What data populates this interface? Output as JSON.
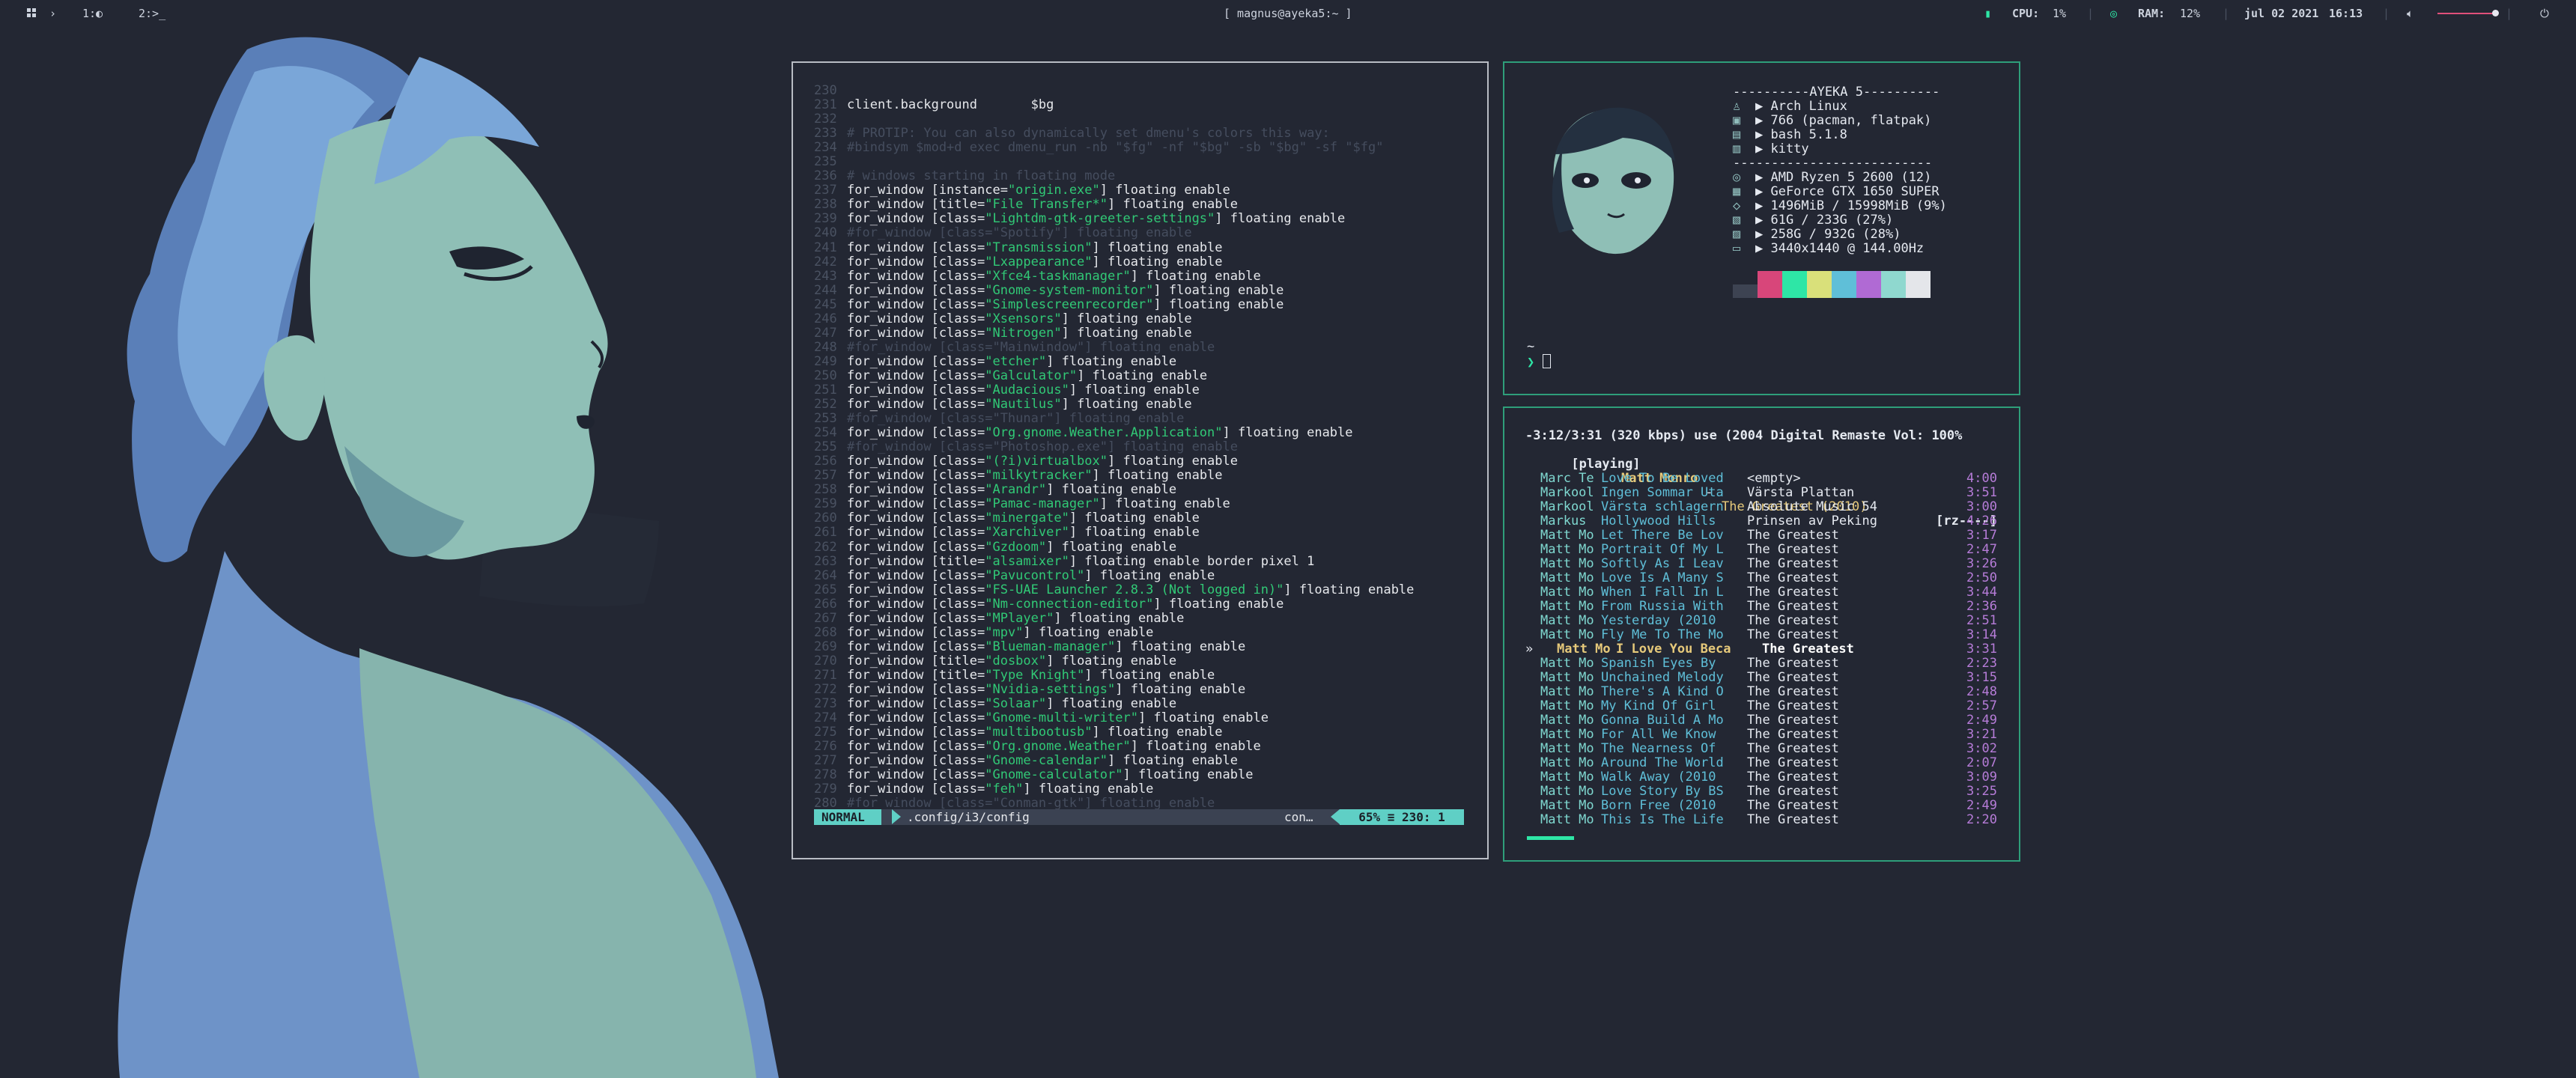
{
  "topbar": {
    "workspaces_icon": "grid-icon",
    "chevron": "›",
    "ws1": "1:◐",
    "ws2": "2:>_",
    "window_title": "[ magnus@ayeka5:~ ]",
    "cpu_label": "CPU:",
    "cpu_value": "1%",
    "ram_label": "RAM:",
    "ram_value": "12%",
    "date": "jul 02 2021",
    "time": "16:13",
    "volume_level": 0.92,
    "accent_color": "#2ee6a6"
  },
  "vim": {
    "lines": [
      {
        "n": "230",
        "segs": []
      },
      {
        "n": "231",
        "segs": [
          {
            "k": "t",
            "v": "client.background       $bg"
          }
        ]
      },
      {
        "n": "232",
        "segs": []
      },
      {
        "n": "233",
        "segs": [
          {
            "k": "c",
            "v": "# PROTIP: You can also dynamically set dmenu's colors this way:"
          }
        ]
      },
      {
        "n": "234",
        "segs": [
          {
            "k": "c",
            "v": "#bindsym $mod+d exec dmenu_run -nb \"$fg\" -nf \"$bg\" -sb \"$bg\" -sf \"$fg\""
          }
        ]
      },
      {
        "n": "235",
        "segs": []
      },
      {
        "n": "236",
        "segs": [
          {
            "k": "c",
            "v": "# windows starting in floating mode"
          }
        ]
      },
      {
        "n": "237",
        "segs": [
          {
            "k": "t",
            "v": "for_window [instance="
          },
          {
            "k": "s",
            "v": "\"origin.exe\""
          },
          {
            "k": "t",
            "v": "] floating enable"
          }
        ]
      },
      {
        "n": "238",
        "segs": [
          {
            "k": "t",
            "v": "for_window [title="
          },
          {
            "k": "s",
            "v": "\"File Transfer*\""
          },
          {
            "k": "t",
            "v": "] floating enable"
          }
        ]
      },
      {
        "n": "239",
        "segs": [
          {
            "k": "t",
            "v": "for_window [class="
          },
          {
            "k": "s",
            "v": "\"Lightdm-gtk-greeter-settings\""
          },
          {
            "k": "t",
            "v": "] floating enable"
          }
        ]
      },
      {
        "n": "240",
        "segs": [
          {
            "k": "c",
            "v": "#for_window [class=\"Spotify\"] floating enable"
          }
        ]
      },
      {
        "n": "241",
        "segs": [
          {
            "k": "t",
            "v": "for_window [class="
          },
          {
            "k": "s",
            "v": "\"Transmission\""
          },
          {
            "k": "t",
            "v": "] floating enable"
          }
        ]
      },
      {
        "n": "242",
        "segs": [
          {
            "k": "t",
            "v": "for_window [class="
          },
          {
            "k": "s",
            "v": "\"Lxappearance\""
          },
          {
            "k": "t",
            "v": "] floating enable"
          }
        ]
      },
      {
        "n": "243",
        "segs": [
          {
            "k": "t",
            "v": "for_window [class="
          },
          {
            "k": "s",
            "v": "\"Xfce4-taskmanager\""
          },
          {
            "k": "t",
            "v": "] floating enable"
          }
        ]
      },
      {
        "n": "244",
        "segs": [
          {
            "k": "t",
            "v": "for_window [class="
          },
          {
            "k": "s",
            "v": "\"Gnome-system-monitor\""
          },
          {
            "k": "t",
            "v": "] floating enable"
          }
        ]
      },
      {
        "n": "245",
        "segs": [
          {
            "k": "t",
            "v": "for_window [class="
          },
          {
            "k": "s",
            "v": "\"Simplescreenrecorder\""
          },
          {
            "k": "t",
            "v": "] floating enable"
          }
        ]
      },
      {
        "n": "246",
        "segs": [
          {
            "k": "t",
            "v": "for_window [class="
          },
          {
            "k": "s",
            "v": "\"Xsensors\""
          },
          {
            "k": "t",
            "v": "] floating enable"
          }
        ]
      },
      {
        "n": "247",
        "segs": [
          {
            "k": "t",
            "v": "for_window [class="
          },
          {
            "k": "s",
            "v": "\"Nitrogen\""
          },
          {
            "k": "t",
            "v": "] floating enable"
          }
        ]
      },
      {
        "n": "248",
        "segs": [
          {
            "k": "c",
            "v": "#for_window [class=\"Mainwindow\"] floating enable"
          }
        ]
      },
      {
        "n": "249",
        "segs": [
          {
            "k": "t",
            "v": "for_window [class="
          },
          {
            "k": "s",
            "v": "\"etcher\""
          },
          {
            "k": "t",
            "v": "] floating enable"
          }
        ]
      },
      {
        "n": "250",
        "segs": [
          {
            "k": "t",
            "v": "for_window [class="
          },
          {
            "k": "s",
            "v": "\"Galculator\""
          },
          {
            "k": "t",
            "v": "] floating enable"
          }
        ]
      },
      {
        "n": "251",
        "segs": [
          {
            "k": "t",
            "v": "for_window [class="
          },
          {
            "k": "s",
            "v": "\"Audacious\""
          },
          {
            "k": "t",
            "v": "] floating enable"
          }
        ]
      },
      {
        "n": "252",
        "segs": [
          {
            "k": "t",
            "v": "for_window [class="
          },
          {
            "k": "s",
            "v": "\"Nautilus\""
          },
          {
            "k": "t",
            "v": "] floating enable"
          }
        ]
      },
      {
        "n": "253",
        "segs": [
          {
            "k": "c",
            "v": "#for_window [class=\"Thunar\"] floating enable"
          }
        ]
      },
      {
        "n": "254",
        "segs": [
          {
            "k": "t",
            "v": "for_window [class="
          },
          {
            "k": "s",
            "v": "\"Org.gnome.Weather.Application\""
          },
          {
            "k": "t",
            "v": "] floating enable"
          }
        ]
      },
      {
        "n": "255",
        "segs": [
          {
            "k": "c",
            "v": "#for_window [class=\"Photoshop.exe\"] floating enable"
          }
        ]
      },
      {
        "n": "256",
        "segs": [
          {
            "k": "t",
            "v": "for_window [class="
          },
          {
            "k": "s",
            "v": "\"(?i)virtualbox\""
          },
          {
            "k": "t",
            "v": "] floating enable"
          }
        ]
      },
      {
        "n": "257",
        "segs": [
          {
            "k": "t",
            "v": "for_window [class="
          },
          {
            "k": "s",
            "v": "\"milkytracker\""
          },
          {
            "k": "t",
            "v": "] floating enable"
          }
        ]
      },
      {
        "n": "258",
        "segs": [
          {
            "k": "t",
            "v": "for_window [class="
          },
          {
            "k": "s",
            "v": "\"Arandr\""
          },
          {
            "k": "t",
            "v": "] floating enable"
          }
        ]
      },
      {
        "n": "259",
        "segs": [
          {
            "k": "t",
            "v": "for_window [class="
          },
          {
            "k": "s",
            "v": "\"Pamac-manager\""
          },
          {
            "k": "t",
            "v": "] floating enable"
          }
        ]
      },
      {
        "n": "260",
        "segs": [
          {
            "k": "t",
            "v": "for_window [class="
          },
          {
            "k": "s",
            "v": "\"minergate\""
          },
          {
            "k": "t",
            "v": "] floating enable"
          }
        ]
      },
      {
        "n": "261",
        "segs": [
          {
            "k": "t",
            "v": "for_window [class="
          },
          {
            "k": "s",
            "v": "\"Xarchiver\""
          },
          {
            "k": "t",
            "v": "] floating enable"
          }
        ]
      },
      {
        "n": "262",
        "segs": [
          {
            "k": "t",
            "v": "for_window [class="
          },
          {
            "k": "s",
            "v": "\"Gzdoom\""
          },
          {
            "k": "t",
            "v": "] floating enable"
          }
        ]
      },
      {
        "n": "263",
        "segs": [
          {
            "k": "t",
            "v": "for_window [title="
          },
          {
            "k": "s",
            "v": "\"alsamixer\""
          },
          {
            "k": "t",
            "v": "] floating enable border pixel 1"
          }
        ]
      },
      {
        "n": "264",
        "segs": [
          {
            "k": "t",
            "v": "for_window [class="
          },
          {
            "k": "s",
            "v": "\"Pavucontrol\""
          },
          {
            "k": "t",
            "v": "] floating enable"
          }
        ]
      },
      {
        "n": "265",
        "segs": [
          {
            "k": "t",
            "v": "for_window [class="
          },
          {
            "k": "s",
            "v": "\"FS-UAE Launcher 2.8.3 (Not logged in)\""
          },
          {
            "k": "t",
            "v": "] floating enable"
          }
        ]
      },
      {
        "n": "266",
        "segs": [
          {
            "k": "t",
            "v": "for_window [class="
          },
          {
            "k": "s",
            "v": "\"Nm-connection-editor\""
          },
          {
            "k": "t",
            "v": "] floating enable"
          }
        ]
      },
      {
        "n": "267",
        "segs": [
          {
            "k": "t",
            "v": "for_window [class="
          },
          {
            "k": "s",
            "v": "\"MPlayer\""
          },
          {
            "k": "t",
            "v": "] floating enable"
          }
        ]
      },
      {
        "n": "268",
        "segs": [
          {
            "k": "t",
            "v": "for_window [class="
          },
          {
            "k": "s",
            "v": "\"mpv\""
          },
          {
            "k": "t",
            "v": "] floating enable"
          }
        ]
      },
      {
        "n": "269",
        "segs": [
          {
            "k": "t",
            "v": "for_window [class="
          },
          {
            "k": "s",
            "v": "\"Blueman-manager\""
          },
          {
            "k": "t",
            "v": "] floating enable"
          }
        ]
      },
      {
        "n": "270",
        "segs": [
          {
            "k": "t",
            "v": "for_window [title="
          },
          {
            "k": "s",
            "v": "\"dosbox\""
          },
          {
            "k": "t",
            "v": "] floating enable"
          }
        ]
      },
      {
        "n": "271",
        "segs": [
          {
            "k": "t",
            "v": "for_window [title="
          },
          {
            "k": "s",
            "v": "\"Type Knight\""
          },
          {
            "k": "t",
            "v": "] floating enable"
          }
        ]
      },
      {
        "n": "272",
        "segs": [
          {
            "k": "t",
            "v": "for_window [class="
          },
          {
            "k": "s",
            "v": "\"Nvidia-settings\""
          },
          {
            "k": "t",
            "v": "] floating enable"
          }
        ]
      },
      {
        "n": "273",
        "segs": [
          {
            "k": "t",
            "v": "for_window [class="
          },
          {
            "k": "s",
            "v": "\"Solaar\""
          },
          {
            "k": "t",
            "v": "] floating enable"
          }
        ]
      },
      {
        "n": "274",
        "segs": [
          {
            "k": "t",
            "v": "for_window [class="
          },
          {
            "k": "s",
            "v": "\"Gnome-multi-writer\""
          },
          {
            "k": "t",
            "v": "] floating enable"
          }
        ]
      },
      {
        "n": "275",
        "segs": [
          {
            "k": "t",
            "v": "for_window [class="
          },
          {
            "k": "s",
            "v": "\"multibootusb\""
          },
          {
            "k": "t",
            "v": "] floating enable"
          }
        ]
      },
      {
        "n": "276",
        "segs": [
          {
            "k": "t",
            "v": "for_window [class="
          },
          {
            "k": "s",
            "v": "\"Org.gnome.Weather\""
          },
          {
            "k": "t",
            "v": "] floating enable"
          }
        ]
      },
      {
        "n": "277",
        "segs": [
          {
            "k": "t",
            "v": "for_window [class="
          },
          {
            "k": "s",
            "v": "\"Gnome-calendar\""
          },
          {
            "k": "t",
            "v": "] floating enable"
          }
        ]
      },
      {
        "n": "278",
        "segs": [
          {
            "k": "t",
            "v": "for_window [class="
          },
          {
            "k": "s",
            "v": "\"Gnome-calculator\""
          },
          {
            "k": "t",
            "v": "] floating enable"
          }
        ]
      },
      {
        "n": "279",
        "segs": [
          {
            "k": "t",
            "v": "for_window [class="
          },
          {
            "k": "s",
            "v": "\"feh\""
          },
          {
            "k": "t",
            "v": "] floating enable"
          }
        ]
      },
      {
        "n": "280",
        "segs": [
          {
            "k": "c",
            "v": "#for_window [class=\"Conman-gtk\"] floating enable"
          }
        ]
      }
    ],
    "status": {
      "mode": "NORMAL",
      "file": ".config/i3/config",
      "filetype": "con…",
      "position": "65% ≡  230:  1"
    }
  },
  "fetch": {
    "header": "----------AYEKA 5----------",
    "sep": "--------------------------",
    "rows1": [
      {
        "icon": "♙",
        "text": "▶ Arch Linux"
      },
      {
        "icon": "▣",
        "text": "▶ 766 (pacman, flatpak)"
      },
      {
        "icon": "▤",
        "text": "▶ bash 5.1.8"
      },
      {
        "icon": "▥",
        "text": "▶ kitty"
      }
    ],
    "rows2": [
      {
        "icon": "◎",
        "text": "▶ AMD Ryzen 5 2600 (12)"
      },
      {
        "icon": "▦",
        "text": "▶ GeForce GTX 1650 SUPER"
      },
      {
        "icon": "◇",
        "text": "▶ 1496MiB / 15998MiB (9%)"
      },
      {
        "icon": "▧",
        "text": "▶ 61G / 233G (27%)"
      },
      {
        "icon": "▨",
        "text": "▶ 258G / 932G (28%)"
      },
      {
        "icon": "▭",
        "text": "▶ 3440x1440 @ 144.00Hz"
      }
    ],
    "swatches": [
      "#3d4352",
      "#d8467a",
      "#2ee6a6",
      "#d9e07a",
      "#5fbfd8",
      "#b06ad4",
      "#8fd8cf",
      "#e4e6ea"
    ],
    "prompt_tilde": "~",
    "prompt_arrow": "❯"
  },
  "cmus": {
    "status_line": "-3:12/3:31 (320 kbps) use (2004 Digital Remaste Vol: 100%",
    "state": "[playing]",
    "artist": "Matt Monro",
    "dash": " - ",
    "title": "The Greatest (2010)",
    "flags": "[rz----]",
    "progress": 0.1,
    "tracks": [
      {
        "ar": "Marc Te",
        "ti": "Love To Be Loved",
        "al": "<empty>",
        "du": "4:00"
      },
      {
        "ar": "Markool",
        "ti": "Ingen Sommar Uta",
        "al": "Värsta Plattan",
        "du": "3:51"
      },
      {
        "ar": "Markool",
        "ti": "Värsta schlagern",
        "al": "Absolute Music 54",
        "du": "3:00"
      },
      {
        "ar": "Markus ",
        "ti": "Hollywood Hills",
        "al": "Prinsen av Peking",
        "du": "4:26"
      },
      {
        "ar": "Matt Mo",
        "ti": "Let There Be Lov",
        "al": "The Greatest",
        "du": "3:17"
      },
      {
        "ar": "Matt Mo",
        "ti": "Portrait Of My L",
        "al": "The Greatest",
        "du": "2:47"
      },
      {
        "ar": "Matt Mo",
        "ti": "Softly As I Leav",
        "al": "The Greatest",
        "du": "3:26"
      },
      {
        "ar": "Matt Mo",
        "ti": "Love Is A Many S",
        "al": "The Greatest",
        "du": "2:50"
      },
      {
        "ar": "Matt Mo",
        "ti": "When I Fall In L",
        "al": "The Greatest",
        "du": "3:44"
      },
      {
        "ar": "Matt Mo",
        "ti": "From Russia With",
        "al": "The Greatest",
        "du": "2:36"
      },
      {
        "ar": "Matt Mo",
        "ti": "Yesterday (2010 ",
        "al": "The Greatest",
        "du": "2:51"
      },
      {
        "ar": "Matt Mo",
        "ti": "Fly Me To The Mo",
        "al": "The Greatest",
        "du": "3:14"
      },
      {
        "ar": "Matt Mo",
        "ti": "I Love You Beca",
        "al": "The Greatest",
        "du": "3:31",
        "cur": true,
        "mk": "»"
      },
      {
        "ar": "Matt Mo",
        "ti": "Spanish Eyes By ",
        "al": "The Greatest",
        "du": "2:23"
      },
      {
        "ar": "Matt Mo",
        "ti": "Unchained Melody",
        "al": "The Greatest",
        "du": "3:15"
      },
      {
        "ar": "Matt Mo",
        "ti": "There's A Kind O",
        "al": "The Greatest",
        "du": "2:48"
      },
      {
        "ar": "Matt Mo",
        "ti": "My Kind Of Girl ",
        "al": "The Greatest",
        "du": "2:57"
      },
      {
        "ar": "Matt Mo",
        "ti": "Gonna Build A Mo",
        "al": "The Greatest",
        "du": "2:49"
      },
      {
        "ar": "Matt Mo",
        "ti": "For All We Know ",
        "al": "The Greatest",
        "du": "3:21"
      },
      {
        "ar": "Matt Mo",
        "ti": "The Nearness Of ",
        "al": "The Greatest",
        "du": "3:02"
      },
      {
        "ar": "Matt Mo",
        "ti": "Around The World",
        "al": "The Greatest",
        "du": "2:07"
      },
      {
        "ar": "Matt Mo",
        "ti": "Walk Away (2010 ",
        "al": "The Greatest",
        "du": "3:09"
      },
      {
        "ar": "Matt Mo",
        "ti": "Love Story By BS",
        "al": "The Greatest",
        "du": "3:25"
      },
      {
        "ar": "Matt Mo",
        "ti": "Born Free (2010 ",
        "al": "The Greatest",
        "du": "2:49"
      },
      {
        "ar": "Matt Mo",
        "ti": "This Is The Life",
        "al": "The Greatest",
        "du": "2:20"
      }
    ]
  }
}
